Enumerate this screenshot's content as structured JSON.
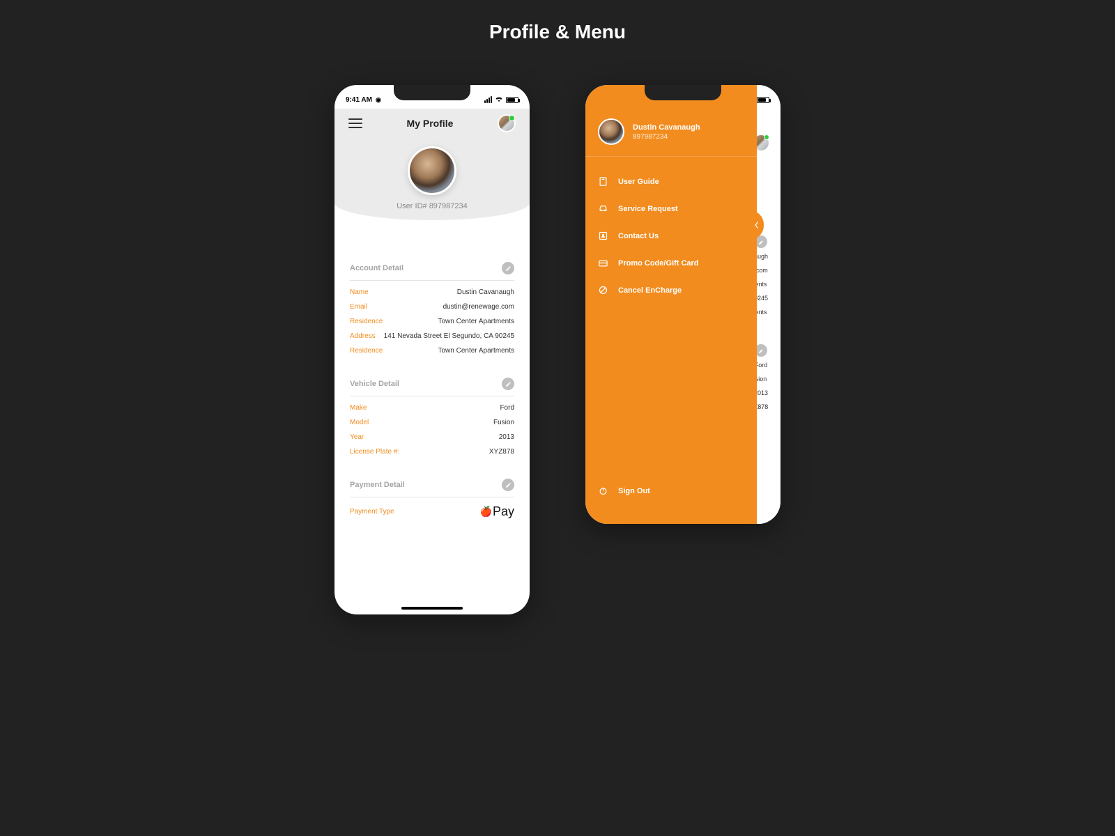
{
  "page_title": "Profile & Menu",
  "status": {
    "time": "9:41 AM"
  },
  "profile": {
    "header": "My Profile",
    "user_id": "User ID# 897987234",
    "account": {
      "title": "Account Detail",
      "rows": [
        {
          "label": "Name",
          "value": "Dustin Cavanaugh"
        },
        {
          "label": "Email",
          "value": "dustin@renewage.com"
        },
        {
          "label": "Residence",
          "value": "Town Center Apartments"
        },
        {
          "label": "Address",
          "value": "141 Nevada Street El Segundo, CA 90245"
        },
        {
          "label": "Residence",
          "value": "Town Center Apartments"
        }
      ]
    },
    "vehicle": {
      "title": "Vehicle Detail",
      "rows": [
        {
          "label": "Make",
          "value": "Ford"
        },
        {
          "label": "Model",
          "value": "Fusion"
        },
        {
          "label": "Year",
          "value": "2013"
        },
        {
          "label": "License Plate #:",
          "value": "XYZ878"
        }
      ]
    },
    "payment": {
      "title": "Payment Detail",
      "type_label": "Payment Type",
      "type_value": "Pay"
    }
  },
  "menu": {
    "user_name": "Dustin Cavanaugh",
    "user_id": "897987234",
    "items": [
      {
        "label": "User Guide"
      },
      {
        "label": "Service Request"
      },
      {
        "label": "Contact Us"
      },
      {
        "label": "Promo Code/Gift Card"
      },
      {
        "label": "Cancel EnCharge"
      }
    ],
    "sign_out": "Sign Out",
    "under_peek": [
      "augh",
      ".com",
      "ents",
      "0245",
      "ents"
    ],
    "under_peek2": [
      "Ford",
      "sion",
      "2013",
      "Z878"
    ]
  }
}
